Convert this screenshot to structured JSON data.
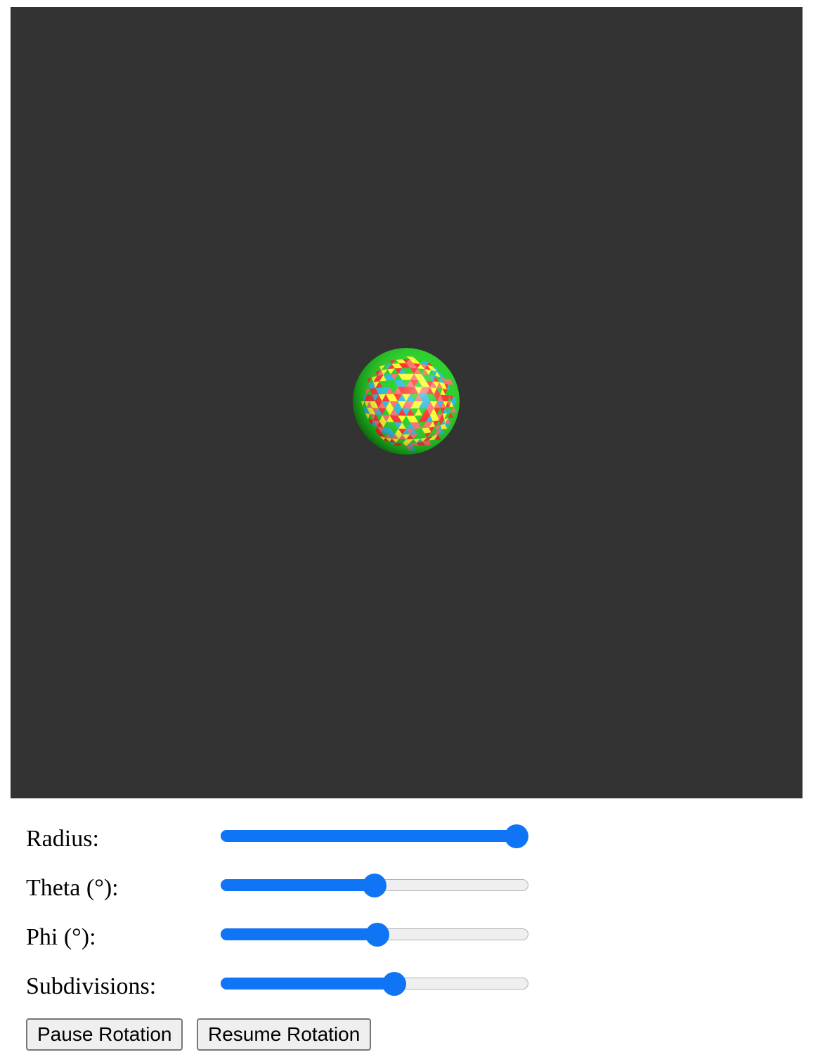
{
  "colors": {
    "viewport_background": "#333333",
    "slider_accent": "#0f75f5",
    "slider_track": "#efefef",
    "button_background": "#efefef",
    "button_border": "#767676",
    "sphere_palette": [
      "#ff2a2a",
      "#1fd11f",
      "#ffff28",
      "#23b8e6",
      "#ff6b6b"
    ]
  },
  "scene": {
    "object": "tessellated-sphere",
    "background_color": "#333333"
  },
  "controls": {
    "radius": {
      "label": "Radius:",
      "value_fraction": 1.0
    },
    "theta": {
      "label": "Theta (°):",
      "value_fraction": 0.5
    },
    "phi": {
      "label": "Phi (°):",
      "value_fraction": 0.51
    },
    "subdivisions": {
      "label": "Subdivisions:",
      "value_fraction": 0.57
    }
  },
  "buttons": {
    "pause_label": "Pause Rotation",
    "resume_label": "Resume Rotation"
  }
}
